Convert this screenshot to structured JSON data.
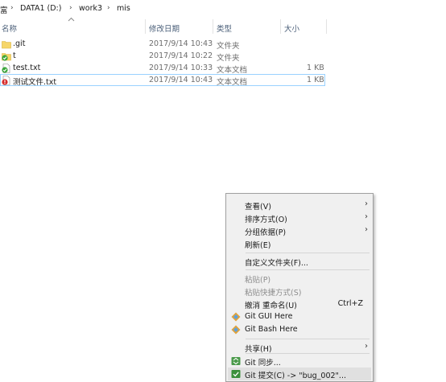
{
  "breadcrumb": {
    "partial": "富",
    "items": [
      "DATA1 (D:)",
      "work3",
      "mis"
    ],
    "separator": "›"
  },
  "columns": {
    "name": "名称",
    "date": "修改日期",
    "type": "类型",
    "size": "大小"
  },
  "files": [
    {
      "name": ".git",
      "date": "2017/9/14 10:43",
      "type": "文件夹",
      "size": "",
      "icon": "folder-icon"
    },
    {
      "name": "t",
      "date": "2017/9/14 10:22",
      "type": "文件夹",
      "size": "",
      "icon": "folder-green-check-icon"
    },
    {
      "name": "test.txt",
      "date": "2017/9/14 10:33",
      "type": "文本文档",
      "size": "1 KB",
      "icon": "file-green-check-icon"
    },
    {
      "name": "测试文件.txt",
      "date": "2017/9/14 10:43",
      "type": "文本文档",
      "size": "1 KB",
      "icon": "file-red-modified-icon"
    }
  ],
  "context_menu": {
    "view": "查看(V)",
    "sort_by": "排序方式(O)",
    "group_by": "分组依据(P)",
    "refresh": "刷新(E)",
    "customize_folder": "自定义文件夹(F)...",
    "paste": "粘贴(P)",
    "paste_shortcut": "粘贴快捷方式(S)",
    "undo_rename": "撤消 重命名(U)",
    "undo_shortcut": "Ctrl+Z",
    "git_gui": "Git GUI Here",
    "git_bash": "Git Bash Here",
    "share": "共享(H)",
    "git_sync": "Git 同步...",
    "git_commit": "Git 提交(C) -> \"bug_002\"..."
  },
  "colors": {
    "folder": "#f6d66a",
    "green_check": "#3aa53a",
    "red_mark": "#d62b2b",
    "selection_border": "#99d1ff",
    "header_text": "#4c607a"
  }
}
